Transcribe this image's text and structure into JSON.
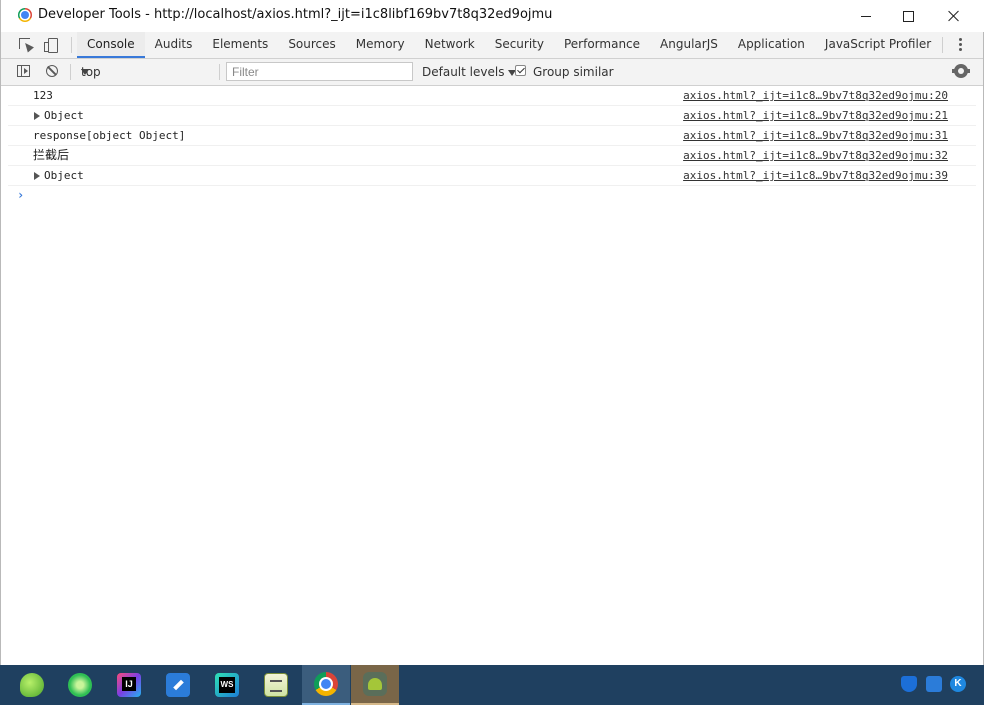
{
  "window": {
    "title": "Developer Tools - http://localhost/axios.html?_ijt=i1c8libf169bv7t8q32ed9ojmu"
  },
  "tabs": [
    "Console",
    "Audits",
    "Elements",
    "Sources",
    "Memory",
    "Network",
    "Security",
    "Performance",
    "AngularJS",
    "Application",
    "JavaScript Profiler"
  ],
  "active_tab": "Console",
  "toolbar": {
    "context": "top",
    "filter_placeholder": "Filter",
    "levels": "Default levels",
    "group_similar": "Group similar",
    "group_similar_checked": true
  },
  "console": {
    "messages": [
      {
        "text": "123",
        "source": "axios.html?_ijt=i1c8…9bv7t8q32ed9ojmu:20",
        "expandable": false
      },
      {
        "text": "Object",
        "source": "axios.html?_ijt=i1c8…9bv7t8q32ed9ojmu:21",
        "expandable": true
      },
      {
        "text": "response[object Object]",
        "source": "axios.html?_ijt=i1c8…9bv7t8q32ed9ojmu:31",
        "expandable": false
      },
      {
        "text": "拦截后",
        "source": "axios.html?_ijt=i1c8…9bv7t8q32ed9ojmu:32",
        "expandable": false
      },
      {
        "text": "Object",
        "source": "axios.html?_ijt=i1c8…9bv7t8q32ed9ojmu:39",
        "expandable": true
      }
    ],
    "prompt_symbol": "›"
  },
  "taskbar": {
    "apps": [
      "leaf-app-icon",
      "ie-browser-icon",
      "intellij-idea-icon",
      "pen-app-icon",
      "webstorm-icon",
      "notepad-icon",
      "chrome-icon",
      "android-studio-icon"
    ],
    "tray": [
      "shield-icon",
      "pen-tray-icon",
      "k-tray-icon"
    ],
    "tray_k_label": "K"
  },
  "colors": {
    "accent": "#3879d9",
    "toolbar_bg": "#f3f3f3",
    "taskbar_bg": "#1f4060"
  }
}
